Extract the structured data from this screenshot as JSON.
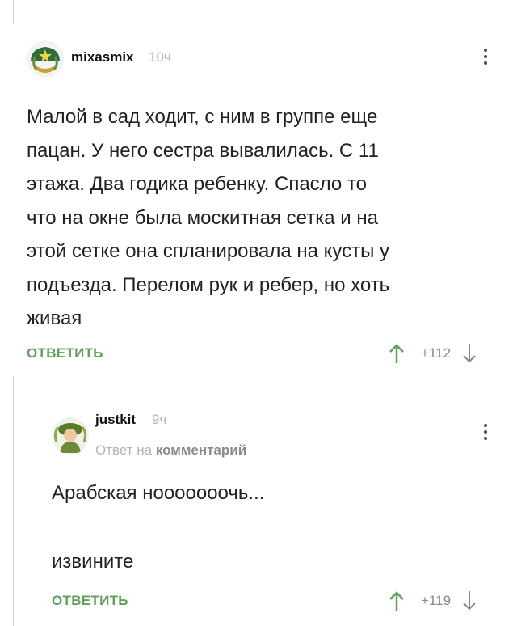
{
  "comment1": {
    "username": "mixasmix",
    "time": "10ч",
    "text_lines": [
      "Малой в сад ходит, с ним в группе еще",
      "пацан. У него сестра вывалилась. С 11",
      "этажа. Два годика ребенку. Спасло то",
      "что на окне была москитная сетка и на",
      "этой сетке она спланировала на кусты у",
      "подъезда. Перелом рук и ребер, но хоть",
      "живая"
    ],
    "reply_label": "ОТВЕТИТЬ",
    "rating": "+112"
  },
  "comment2": {
    "username": "justkit",
    "time": "9ч",
    "reply_to_prefix": "Ответ на",
    "reply_to_link": "комментарий",
    "text_line1": "Арабская нооооооочь...",
    "text_line2": "извините",
    "reply_label": "ОТВЕТИТЬ",
    "rating": "+119"
  },
  "colors": {
    "accent_green": "#5fa15a",
    "vote_up_green": "#5fa15a",
    "muted_gray": "#b5b5b5",
    "thread_line": "#d6d6d6"
  },
  "icons": {
    "vote_up": "arrow-up-icon",
    "vote_down": "arrow-down-icon",
    "more": "more-vertical-icon"
  }
}
